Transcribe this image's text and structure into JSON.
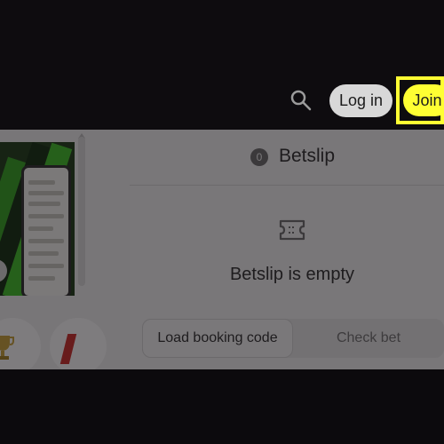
{
  "header": {
    "search_icon": "search-icon",
    "login_label": "Log in",
    "join_label": "Join",
    "join_highlight_color": "#ffff33"
  },
  "betslip": {
    "count": "0",
    "title": "Betslip",
    "empty_icon": "ticket-icon",
    "empty_message": "Betslip is empty",
    "tabs": [
      {
        "label": "Load booking code",
        "active": true
      },
      {
        "label": "Check bet",
        "active": false
      }
    ]
  },
  "left_panel": {
    "icons": [
      "trophy-icon",
      "flag-icon"
    ]
  },
  "colors": {
    "page_background": "#0c0a0d",
    "panel_background": "#f4f4f4",
    "accent": "#ffff33"
  }
}
